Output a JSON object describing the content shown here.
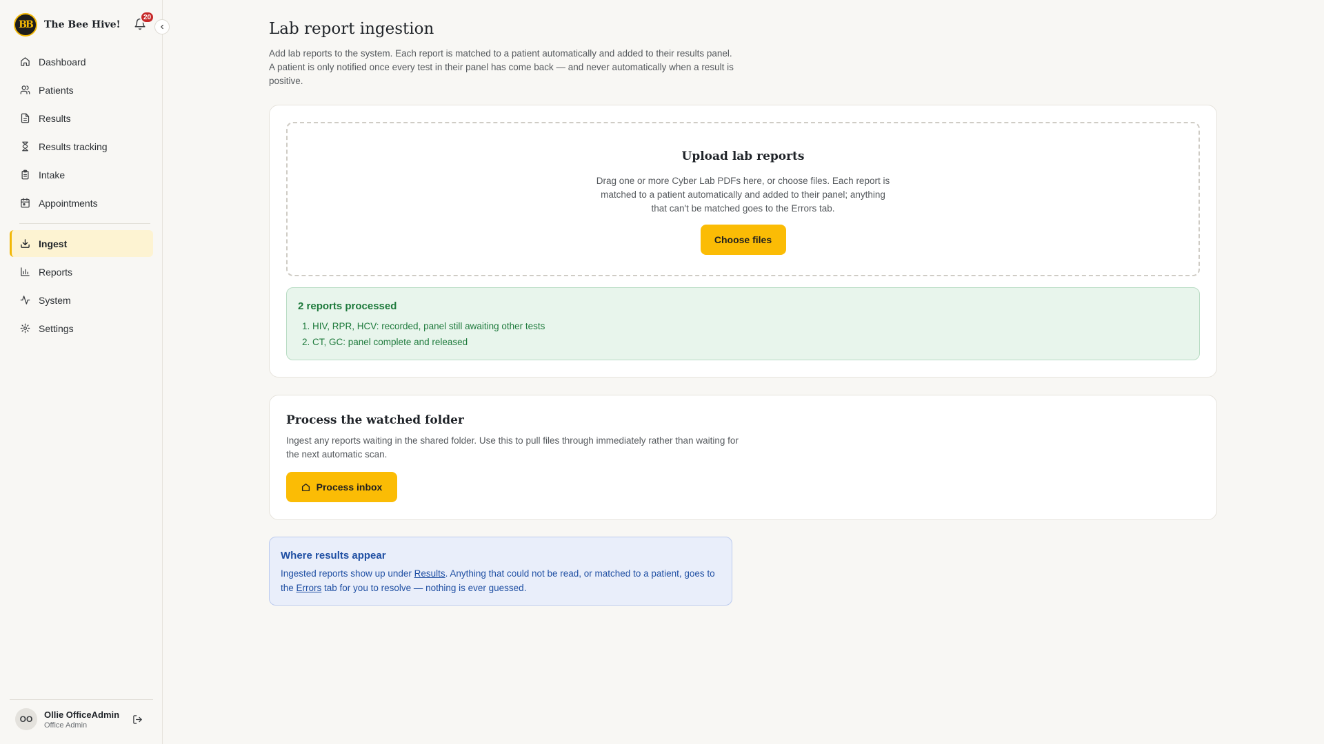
{
  "app": {
    "name": "The Bee Hive!",
    "logo_text": "BB",
    "notifications_count": "20"
  },
  "sidebar": {
    "items": [
      {
        "label": "Dashboard",
        "icon": "home-icon"
      },
      {
        "label": "Patients",
        "icon": "users-icon"
      },
      {
        "label": "Results",
        "icon": "file-icon"
      },
      {
        "label": "Results tracking",
        "icon": "hourglass-icon"
      },
      {
        "label": "Intake",
        "icon": "clipboard-icon"
      },
      {
        "label": "Appointments",
        "icon": "calendar-icon"
      },
      {
        "label": "Ingest",
        "icon": "download-icon",
        "active": true
      },
      {
        "label": "Reports",
        "icon": "bar-chart-icon"
      },
      {
        "label": "System",
        "icon": "activity-icon"
      },
      {
        "label": "Settings",
        "icon": "gear-icon"
      }
    ]
  },
  "user": {
    "initials": "OO",
    "name": "Ollie OfficeAdmin",
    "role": "Office Admin"
  },
  "page": {
    "title": "Lab report ingestion",
    "description": "Add lab reports to the system. Each report is matched to a patient automatically and added to their results panel. A patient is only notified once every test in their panel has come back — and never automatically when a result is positive."
  },
  "upload": {
    "title": "Upload lab reports",
    "text": "Drag one or more Cyber Lab PDFs here, or choose files. Each report is matched to a patient automatically and added to their panel; anything that can't be matched goes to the Errors tab.",
    "button_label": "Choose files"
  },
  "processed": {
    "title": "2 reports processed",
    "items": [
      "1. HIV, RPR, HCV: recorded, panel still awaiting other tests",
      "2. CT, GC: panel complete and released"
    ]
  },
  "folder": {
    "title": "Process the watched folder",
    "text": "Ingest any reports waiting in the shared folder. Use this to pull files through immediately rather than waiting for the next automatic scan.",
    "button_label": "Process inbox"
  },
  "info": {
    "title": "Where results appear",
    "text_1": "Ingested reports show up under ",
    "link_results": "Results",
    "text_2": ". Anything that could not be read, or matched to a patient, goes to the ",
    "link_errors": "Errors",
    "text_3": " tab for you to resolve — nothing is ever guessed."
  },
  "colors": {
    "accent": "#fbbc05",
    "success": "#1e7a3c",
    "info": "#1f4fa3",
    "badge": "#c62828"
  }
}
